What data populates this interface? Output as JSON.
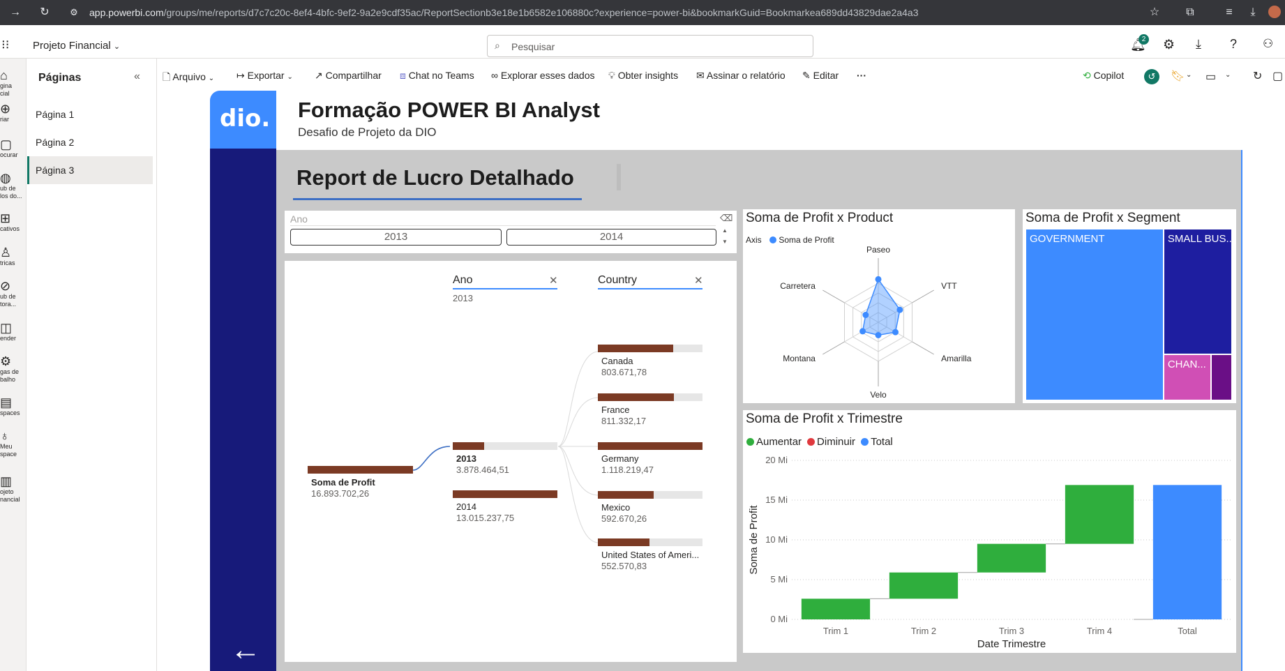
{
  "browser": {
    "url_host": "app.powerbi.com",
    "url_path": "/groups/me/reports/d7c7c20c-8ef4-4bfc-9ef2-9a2e9cdf35ac/ReportSectionb3e18e1b6582e106880c?experience=power-bi&bookmarkGuid=Bookmarkea689dd43829dae2a4a3"
  },
  "app": {
    "workspace_name": "Projeto Financial",
    "search_placeholder": "Pesquisar",
    "notification_count": "2"
  },
  "rail": {
    "items": [
      {
        "icon": "home-icon",
        "label": "gina\ncial"
      },
      {
        "icon": "plus-icon",
        "label": "riar"
      },
      {
        "icon": "folder-icon",
        "label": "ocurar"
      },
      {
        "icon": "hub-icon",
        "label": "ub de\nlos do..."
      },
      {
        "icon": "apps-icon",
        "label": "cativos"
      },
      {
        "icon": "trophy-icon",
        "label": "tricas"
      },
      {
        "icon": "compass-icon",
        "label": "ub de\ntora..."
      },
      {
        "icon": "book-icon",
        "label": "ender"
      },
      {
        "icon": "gear-icon",
        "label": "gas de\nbalho"
      },
      {
        "icon": "workspaces-icon",
        "label": "spaces"
      },
      {
        "icon": "person-icon",
        "label": "Meu\nspace"
      },
      {
        "icon": "report-icon",
        "label": "ojeto\nnancial"
      }
    ]
  },
  "pages": {
    "title": "Páginas",
    "items": [
      "Página 1",
      "Página 2",
      "Página 3"
    ],
    "active_index": 2
  },
  "toolbar": {
    "file": "Arquivo",
    "export": "Exportar",
    "share": "Compartilhar",
    "teams": "Chat no Teams",
    "explore": "Explorar esses dados",
    "insights": "Obter insights",
    "subscribe": "Assinar o relatório",
    "edit": "Editar",
    "more": "···",
    "copilot": "Copilot"
  },
  "report": {
    "title": "Formação POWER BI Analyst",
    "subtitle": "Desafio de Projeto da DIO",
    "logo_text": "dio.",
    "section_title": "Report de Lucro Detalhado",
    "back_arrow": "←"
  },
  "slicer": {
    "header": "Ano",
    "options": [
      "2013",
      "2014"
    ]
  },
  "decomposition_tree": {
    "level1_header": "Ano",
    "level1_selected": "2013",
    "level2_header": "Country",
    "root": {
      "label": "Soma de Profit",
      "value": "16.893.702,26"
    },
    "years": [
      {
        "label": "2013",
        "value": "3.878.464,51",
        "bold": true,
        "fraction": 0.298
      },
      {
        "label": "2014",
        "value": "13.015.237,75",
        "bold": false,
        "fraction": 1.0
      }
    ],
    "countries": [
      {
        "label": "Canada",
        "value": "803.671,78",
        "fraction": 0.719
      },
      {
        "label": "France",
        "value": "811.332,17",
        "fraction": 0.726
      },
      {
        "label": "Germany",
        "value": "1.118.219,47",
        "fraction": 1.0
      },
      {
        "label": "Mexico",
        "value": "592.670,26",
        "fraction": 0.53
      },
      {
        "label": "United States of Ameri...",
        "value": "552.570,83",
        "fraction": 0.494
      }
    ]
  },
  "radar": {
    "title": "Soma de Profit x Product",
    "legend_axis": "Axis",
    "legend_series": "Soma de Profit",
    "color": "#3d8bff"
  },
  "treemap": {
    "title": "Soma de Profit x Segment",
    "labels": [
      "GOVERNMENT",
      "SMALL BUS...",
      "CHAN...",
      ""
    ],
    "colors": [
      "#3d8bff",
      "#1e1ea0",
      "#d04fb5",
      "#6a0f86"
    ]
  },
  "waterfall": {
    "title": "Soma de Profit x Trimestre",
    "legend": [
      {
        "label": "Aumentar",
        "color": "#2fae3d"
      },
      {
        "label": "Diminuir",
        "color": "#e0393e"
      },
      {
        "label": "Total",
        "color": "#3d8bff"
      }
    ],
    "ylabel": "Soma de Profit",
    "xlabel": "Date Trimestre",
    "yticks": [
      "20 Mi",
      "15 Mi",
      "10 Mi",
      "5 Mi",
      "0 Mi"
    ]
  },
  "chart_data": [
    {
      "type": "radar",
      "title": "Soma de Profit x Product",
      "categories": [
        "Paseo",
        "VTT",
        "Amarilla",
        "Velo",
        "Montana",
        "Carretera"
      ],
      "series": [
        {
          "name": "Soma de Profit",
          "values": [
            5.0,
            2.9,
            2.3,
            1.5,
            2.1,
            1.7
          ]
        }
      ],
      "rlim": [
        0,
        10
      ]
    },
    {
      "type": "treemap",
      "title": "Soma de Profit x Segment",
      "categories": [
        "GOVERNMENT",
        "SMALL BUS...",
        "CHAN...",
        ""
      ],
      "values": [
        11.39,
        4.14,
        1.05,
        0.46
      ]
    },
    {
      "type": "waterfall",
      "title": "Soma de Profit x Trimestre",
      "categories": [
        "Trim 1",
        "Trim 2",
        "Trim 3",
        "Trim 4",
        "Total"
      ],
      "values": [
        2.6,
        3.3,
        3.6,
        7.4,
        16.9
      ],
      "kinds": [
        "increase",
        "increase",
        "increase",
        "increase",
        "total"
      ],
      "xlabel": "Date Trimestre",
      "ylabel": "Soma de Profit",
      "ylim": [
        0,
        20
      ],
      "unit": "Mi"
    }
  ]
}
